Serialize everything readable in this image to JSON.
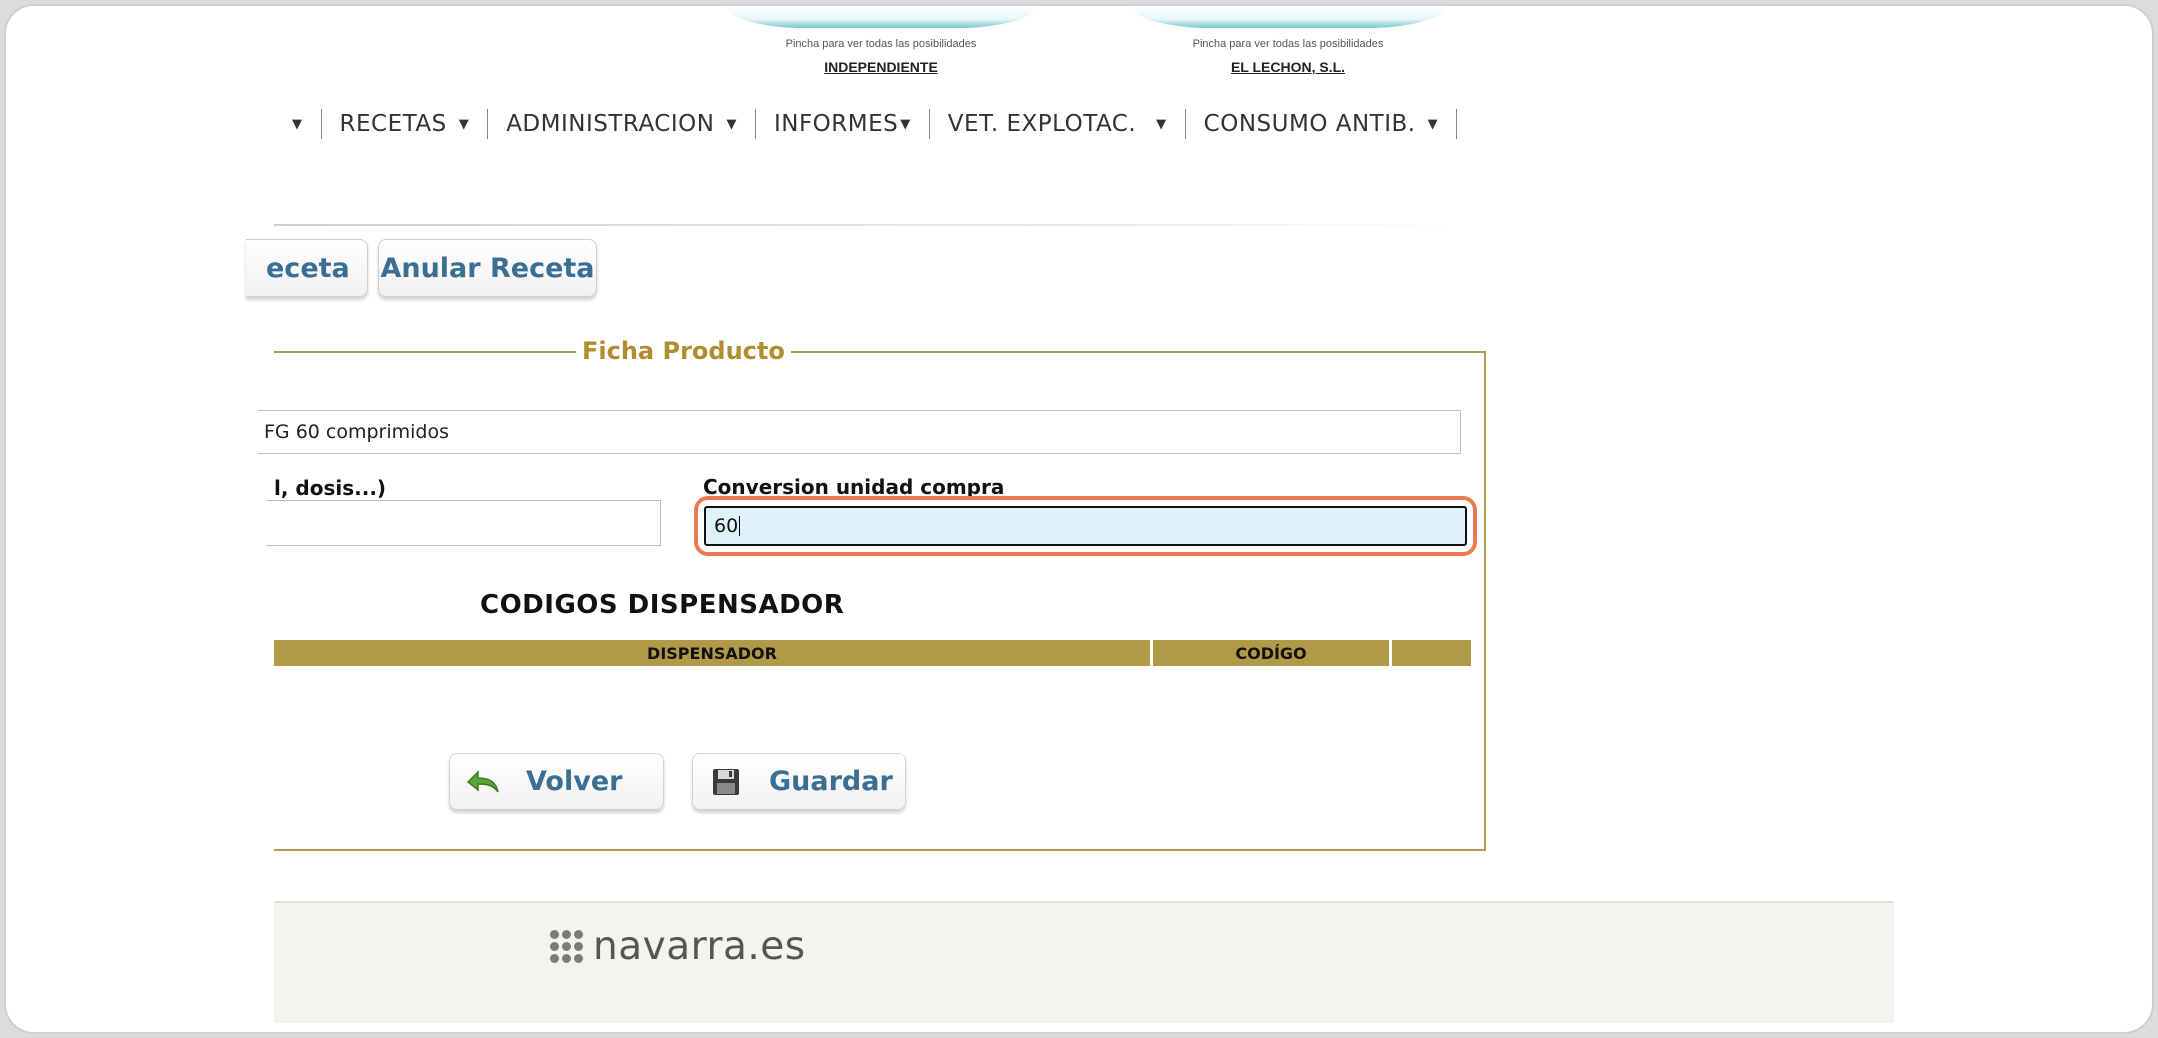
{
  "header": {
    "hint_text": "Pincha para ver todas las posibilidades",
    "entity_left": "INDEPENDIENTE",
    "entity_right": "EL LECHON, S.L."
  },
  "nav": {
    "items": [
      {
        "label": ""
      },
      {
        "label": "RECETAS"
      },
      {
        "label": "ADMINISTRACION"
      },
      {
        "label": "INFORMES"
      },
      {
        "label": "VET. EXPLOTAC."
      },
      {
        "label": "CONSUMO ANTIB."
      }
    ]
  },
  "tabs": {
    "prev_label": "eceta",
    "anular_label": "Anular Receta"
  },
  "ficha": {
    "legend": "Ficha Producto",
    "description_value": "FG  60 comprimidos",
    "dosis_label": "l, dosis...)",
    "dosis_value": "",
    "conversion_label": "Conversion unidad compra",
    "conversion_value": "60"
  },
  "codigos": {
    "title": "CODIGOS DISPENSADOR",
    "columns": [
      "DISPENSADOR",
      "CODÍGO",
      ""
    ]
  },
  "actions": {
    "volver_label": "Volver",
    "guardar_label": "Guardar"
  },
  "footer": {
    "logo_text": "navarra.es"
  },
  "colors": {
    "accent_gold": "#b09a47",
    "button_text": "#3a6f93",
    "focus_highlight": "#ec7a4c",
    "input_focus_bg": "#def3f9"
  }
}
